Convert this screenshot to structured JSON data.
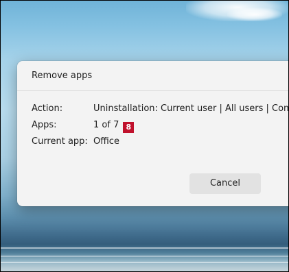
{
  "dialog": {
    "title": "Remove apps",
    "action_label": "Action:",
    "action_value": "Uninstallation: Current user | All users | Comp",
    "apps_label": "Apps:",
    "apps_value": "1 of 7",
    "current_app_label": "Current app:",
    "current_app_value": "Office",
    "cancel_label": "Cancel"
  },
  "annotation": {
    "marker": "8",
    "color": "#c0112c"
  }
}
